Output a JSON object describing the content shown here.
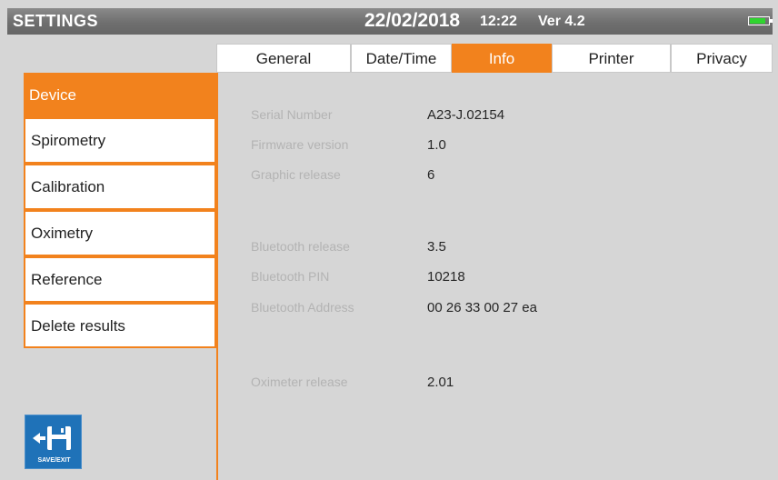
{
  "header": {
    "title": "SETTINGS",
    "date": "22/02/2018",
    "time": "12:22",
    "version": "Ver 4.2",
    "battery_icon": "battery-icon",
    "battery_level": 0.85,
    "battery_color": "#2fd42f"
  },
  "tabs": [
    {
      "label": "General",
      "active": false
    },
    {
      "label": "Date/Time",
      "active": false
    },
    {
      "label": "Info",
      "active": true
    },
    {
      "label": "Printer",
      "active": false
    },
    {
      "label": "Privacy",
      "active": false
    }
  ],
  "sidebar": {
    "items": [
      {
        "label": "Device",
        "active": true
      },
      {
        "label": "Spirometry",
        "active": false
      },
      {
        "label": "Calibration",
        "active": false
      },
      {
        "label": "Oximetry",
        "active": false
      },
      {
        "label": "Reference",
        "active": false
      },
      {
        "label": "Delete  results",
        "active": false
      }
    ]
  },
  "info": {
    "serial_number": {
      "label": "Serial Number",
      "value": "A23-J.02154"
    },
    "firmware_version": {
      "label": "Firmware version",
      "value": "1.0"
    },
    "graphic_release": {
      "label": "Graphic release",
      "value": "6"
    },
    "bluetooth_release": {
      "label": "Bluetooth release",
      "value": "3.5"
    },
    "bluetooth_pin": {
      "label": "Bluetooth PIN",
      "value": "10218"
    },
    "bluetooth_address": {
      "label": "Bluetooth Address",
      "value": "00 26 33 00 27 ea"
    },
    "oximeter_release": {
      "label": "Oximeter release",
      "value": "2.01"
    }
  },
  "save_exit": {
    "label": "SAVE/EXIT",
    "icon": "save-exit-icon"
  },
  "colors": {
    "accent": "#f2821d",
    "header_bg": "#757575",
    "content_bg": "#d6d6d6",
    "button_blue": "#1f72b8"
  }
}
